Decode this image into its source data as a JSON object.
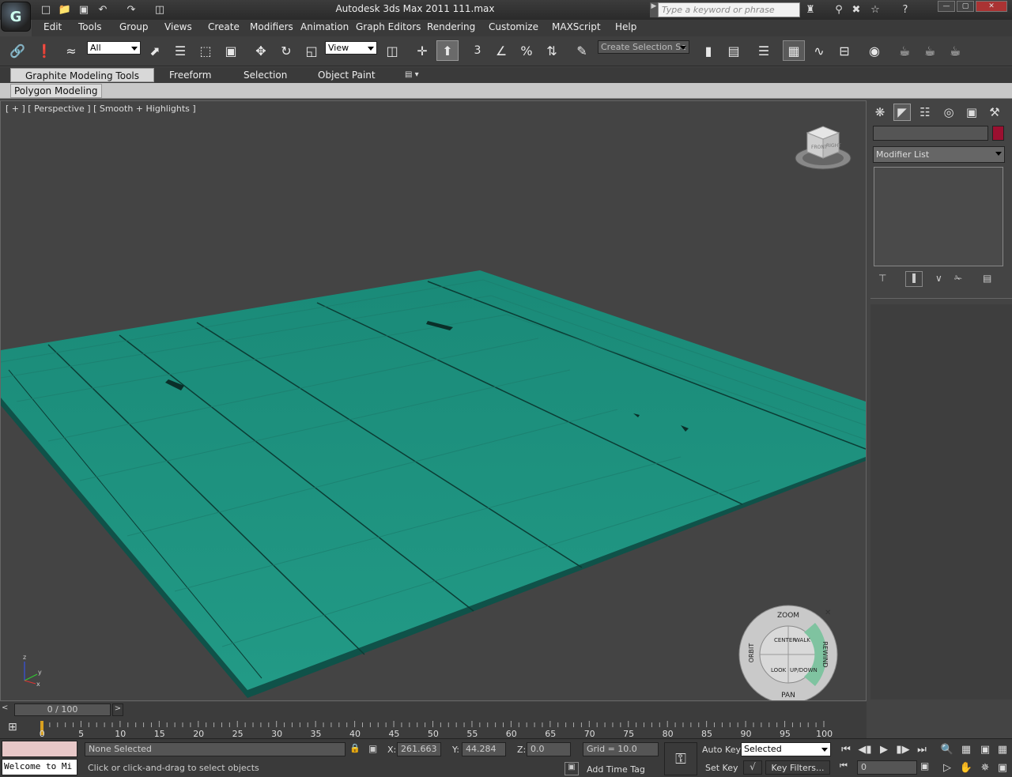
{
  "titlebar": {
    "title": "Autodesk 3ds Max  2011      111.max",
    "search_placeholder": "Type a keyword or phrase",
    "app_icon_label": "G"
  },
  "menu": [
    "Edit",
    "Tools",
    "Group",
    "Views",
    "Create",
    "Modifiers",
    "Animation",
    "Graph Editors",
    "Rendering",
    "Customize",
    "MAXScript",
    "Help"
  ],
  "toolbar": {
    "selection_filter": "All",
    "ref_coord": "View",
    "named_selection": "Create Selection Se",
    "snap_label": "3"
  },
  "ribbon": {
    "tabs": [
      "Graphite Modeling Tools",
      "Freeform",
      "Selection",
      "Object Paint"
    ],
    "panel_button": "Polygon Modeling"
  },
  "viewport": {
    "label": "[ + ] [ Perspective ] [ Smooth + Highlights ]",
    "viewcube_faces": [
      "FRONT",
      "RIGHT"
    ],
    "wheel": {
      "zoom": "ZOOM",
      "orbit": "ORBIT",
      "rewind": "REWIND",
      "pan": "PAN",
      "center": "CENTER",
      "walk": "WALK",
      "look": "LOOK",
      "updown": "UP/DOWN"
    },
    "axes": {
      "z": "z",
      "y": "y",
      "x": "x"
    }
  },
  "command_panel": {
    "modifier_list": "Modifier List",
    "color_swatch": "#9b1030"
  },
  "colors": {
    "plane": "#1f9682",
    "plane_dark": "#11574c",
    "bg": "#444444"
  },
  "timeline": {
    "frame": "0 / 100",
    "ticks": [
      "0",
      "5",
      "10",
      "15",
      "20",
      "25",
      "30",
      "35",
      "40",
      "45",
      "50",
      "55",
      "60",
      "65",
      "70",
      "75",
      "80",
      "85",
      "90",
      "95",
      "100"
    ]
  },
  "status": {
    "maxscript": "Welcome to Mi",
    "selection": "None Selected",
    "prompt": "Click or click-and-drag to select objects",
    "x": "261.663",
    "y": "44.284",
    "z": "0.0",
    "x_label": "X:",
    "y_label": "Y:",
    "z_label": "Z:",
    "grid": "Grid = 10.0",
    "add_time_tag": "Add Time Tag",
    "auto_key": "Auto Key",
    "set_key": "Set Key",
    "key_mode": "Selected",
    "key_filters": "Key Filters...",
    "current_frame": "0"
  }
}
